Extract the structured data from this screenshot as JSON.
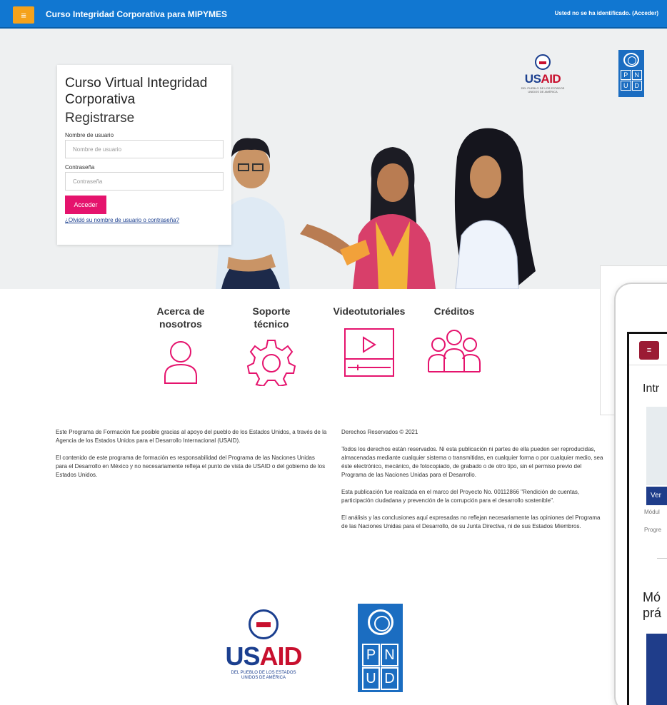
{
  "navbar": {
    "menu_icon": "hamburger-icon",
    "site_title": "Curso Integridad Corporativa para MIPYMES",
    "login_status": "Usted no se ha identificado. (Acceder)",
    "colors": {
      "bar": "#1177d1",
      "menu_button": "#f5a21b"
    }
  },
  "login": {
    "course_title": "Curso Virtual Integridad Corporativa",
    "register_heading": "Registrarse",
    "username_label": "Nombre de usuario",
    "username_placeholder": "Nombre de usuario",
    "password_label": "Contraseña",
    "password_placeholder": "Contraseña",
    "submit_label": "Acceder",
    "forgot_link": "¿Olvidó su nombre de usuario o contraseña?",
    "accent_color": "#e5136d"
  },
  "logos": {
    "usaid_text_a": "US",
    "usaid_text_b": "AID",
    "usaid_tagline_top": "DEL PUEBLO DE LOS ESTADOS UNIDOS DE AMÉRICA",
    "usaid_tagline_line1": "DEL PUEBLO DE LOS ESTADOS",
    "usaid_tagline_line2": "UNIDOS DE AMÉRICA",
    "pnud_letters": [
      "P",
      "N",
      "U",
      "D"
    ]
  },
  "info_links": [
    {
      "label_line1": "Acerca de",
      "label_line2": "nosotros",
      "icon": "user-icon"
    },
    {
      "label_line1": "Soporte",
      "label_line2": "técnico",
      "icon": "gear-icon"
    },
    {
      "label_line1": "Videotutoriales",
      "label_line2": "",
      "icon": "video-player-icon"
    },
    {
      "label_line1": "Créditos",
      "label_line2": "",
      "icon": "group-icon"
    }
  ],
  "footer": {
    "left_p1": "Este Programa de Formación fue posible gracias al apoyo del pueblo de los Estados Unidos, a través de la Agencia de los Estados Unidos para el Desarrollo Internacional (USAID).",
    "left_p2": "El contenido de este programa de formación es responsabilidad del Programa de las Naciones Unidas para el Desarrollo en México y no necesariamente refleja el punto de vista de USAID o del gobierno de los Estados Unidos.",
    "right_p1": "Derechos Reservados © 2021",
    "right_p2": "Todos los derechos están reservados. Ni esta publicación ni partes de ella pueden ser reproducidas, almacenadas mediante cualquier sistema o transmitidas, en cualquier forma o por cualquier medio, sea éste electrónico, mecánico, de fotocopiado, de grabado o de otro tipo, sin el permiso previo del Programa de las Naciones Unidas para el Desarrollo.",
    "right_p3": "Esta publicación fue realizada en el marco del Proyecto No. 00112866 \"Rendición de cuentas, participación ciudadana y prevención de la corrupción para el desarrollo sostenible\".",
    "right_p4": "El análisis y las conclusiones aquí expresadas no reflejan necesariamente las opiniones del Programa de las Naciones Unidas para el Desarrollo, de su Junta Directiva, ni de sus Estados Miembros."
  },
  "device": {
    "menu_icon": "hamburger-icon",
    "title1": "Intr",
    "button": "Ver",
    "small1": "Módul",
    "small2": "Progre",
    "title2_line1": "Mó",
    "title2_line2": "prá"
  }
}
